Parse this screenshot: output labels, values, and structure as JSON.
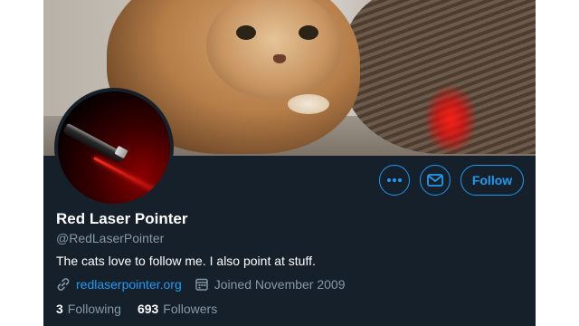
{
  "profile": {
    "name": "Red Laser Pointer",
    "handle": "@RedLaserPointer",
    "bio": "The cats love to follow me. I also point at stuff.",
    "website": "redlaserpointer.org",
    "joined": "Joined November 2009",
    "following_count": "3",
    "following_label": "Following",
    "followers_count": "693",
    "followers_label": "Followers"
  },
  "actions": {
    "more_icon": "more-icon",
    "message_icon": "mail-icon",
    "follow_label": "Follow"
  },
  "colors": {
    "background": "#15202b",
    "accent": "#1d9bf0",
    "secondary_text": "#8899a6",
    "primary_text": "#ffffff"
  }
}
